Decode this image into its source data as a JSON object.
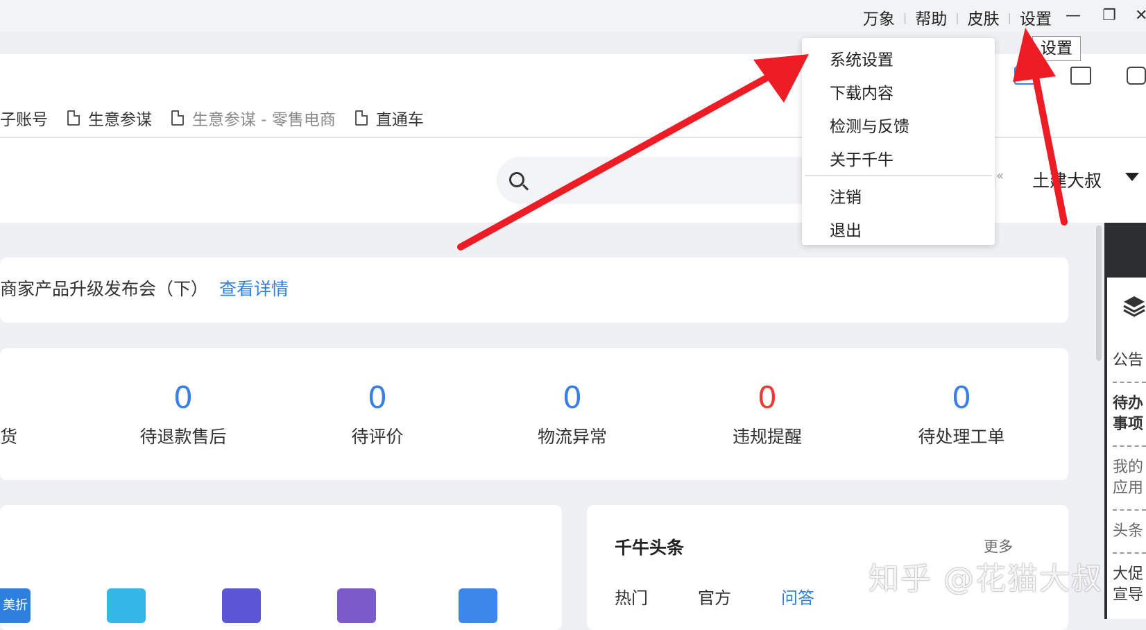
{
  "titlebar": {
    "links": [
      "万象",
      "帮助",
      "皮肤",
      "设置"
    ],
    "minimize": "—",
    "maximize": "❐",
    "close": "✕"
  },
  "tooltip": "设置",
  "tabs": [
    "子账号",
    "生意参谋",
    "生意参谋 - 零售电商",
    "直通车"
  ],
  "user": {
    "name": "土建大叔"
  },
  "settings_menu": {
    "items": [
      "系统设置",
      "下载内容",
      "检测与反馈",
      "关于千牛"
    ],
    "items2": [
      "注销",
      "退出"
    ]
  },
  "notice": {
    "text": "商家产品升级发布会（下）",
    "link": "查看详情"
  },
  "stats": [
    {
      "value": "0",
      "label": "货"
    },
    {
      "value": "0",
      "label": "待退款售后"
    },
    {
      "value": "0",
      "label": "待评价"
    },
    {
      "value": "0",
      "label": "物流异常"
    },
    {
      "value": "0",
      "label": "违规提醒"
    },
    {
      "value": "0",
      "label": "待处理工单"
    }
  ],
  "news": {
    "title": "千牛头条",
    "more": "更多",
    "tabs": [
      "热门",
      "官方",
      "问答"
    ],
    "active_tab": "问答"
  },
  "right_sidebar": [
    "公告",
    "待办",
    "事项",
    "我的",
    "应用",
    "头条",
    "大促",
    "宣导"
  ],
  "app_icons": [
    {
      "label": "美折",
      "color": "#2f7fe0"
    },
    {
      "label": "",
      "color": "#35b6e8"
    },
    {
      "label": "",
      "color": "#5b56d6"
    },
    {
      "label": "",
      "color": "#7a5bc9"
    },
    {
      "label": "",
      "color": "#3d86ea"
    }
  ],
  "watermark": "知乎 @花猫大叔",
  "colors": {
    "accent": "#2f7fe0",
    "alert": "#ea3a34",
    "arrow": "#ee1c24"
  }
}
